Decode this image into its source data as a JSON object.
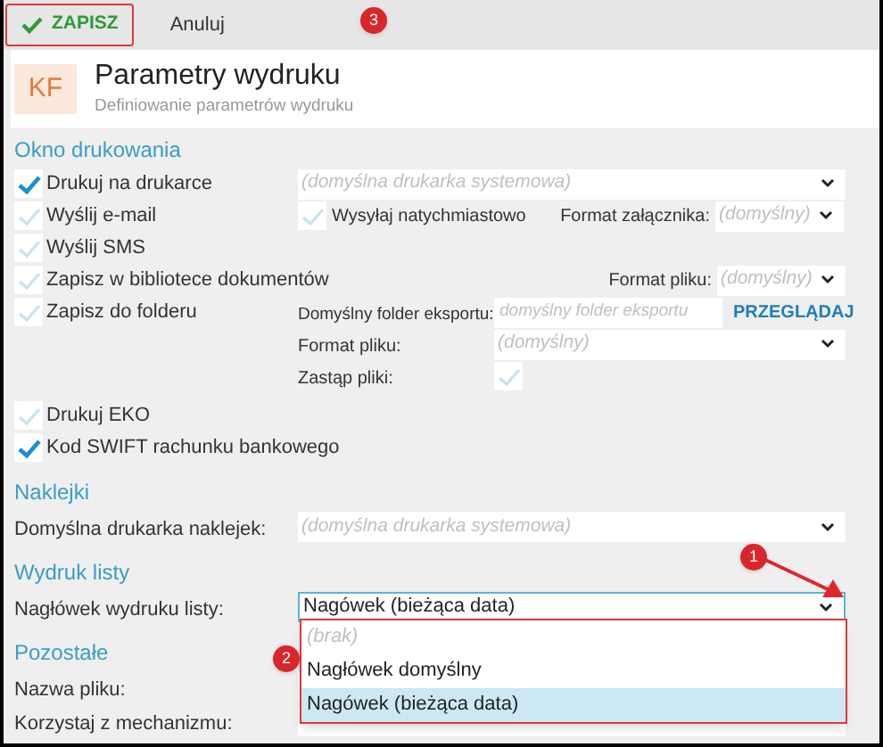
{
  "toolbar": {
    "save": "ZAPISZ",
    "cancel": "Anuluj"
  },
  "header": {
    "logo": "KF",
    "title": "Parametry wydruku",
    "subtitle": "Definiowanie parametrów wydruku"
  },
  "print_window": {
    "title": "Okno drukowania",
    "options": [
      {
        "kind": "select",
        "label": "Drukuj na drukarce",
        "checked": true,
        "select": {
          "placeholder": "(domyślna drukarka systemowa)"
        }
      },
      {
        "kind": "email",
        "label": "Wyślij e-mail",
        "checked": false,
        "immediate": {
          "label": "Wysyłaj natychmiastowo",
          "checked": false
        },
        "format": {
          "label": "Format załącznika:",
          "placeholder": "(domyślny)"
        }
      },
      {
        "kind": "plain",
        "label": "Wyślij SMS",
        "checked": false
      },
      {
        "kind": "format",
        "label": "Zapisz w bibliotece dokumentów",
        "checked": false,
        "format": {
          "label": "Format pliku:",
          "placeholder": "(domyślny)"
        }
      },
      {
        "kind": "folder",
        "label": "Zapisz do folderu",
        "checked": false,
        "folder": {
          "label": "Domyślny folder eksportu:",
          "placeholder": "domyślny folder eksportu",
          "browse": "PRZEGLĄDAJ"
        },
        "format": {
          "label": "Format pliku:",
          "placeholder": "(domyślny)"
        },
        "replace": {
          "label": "Zastąp pliki:",
          "checked": false
        }
      },
      {
        "kind": "plain",
        "label": "Drukuj EKO",
        "checked": false
      },
      {
        "kind": "plain",
        "label": "Kod SWIFT rachunku bankowego",
        "checked": true
      }
    ]
  },
  "stickers": {
    "title": "Naklejki",
    "fields": [
      {
        "label": "Domyślna drukarka naklejek:",
        "placeholder": "(domyślna drukarka systemowa)"
      }
    ]
  },
  "list_print": {
    "title": "Wydruk listy",
    "fields": [
      {
        "label": "Nagłówek wydruku listy:",
        "value": "Nagówek (bieżąca data)",
        "focused": true
      }
    ]
  },
  "other": {
    "title": "Pozostałe",
    "fields": [
      {
        "label": "Nazwa pliku:"
      },
      {
        "label": "Korzystaj z mechanizmu:"
      }
    ]
  },
  "dropdown": {
    "options": [
      {
        "kind": "empty",
        "label": "(brak)",
        "selected": false
      },
      {
        "kind": "option",
        "label": "Nagłówek domyślny",
        "selected": false
      },
      {
        "kind": "option",
        "label": "Nagówek (bieżąca data)",
        "selected": true
      }
    ]
  },
  "annotations": [
    {
      "number": "3"
    },
    {
      "number": "1"
    },
    {
      "number": "2"
    }
  ]
}
